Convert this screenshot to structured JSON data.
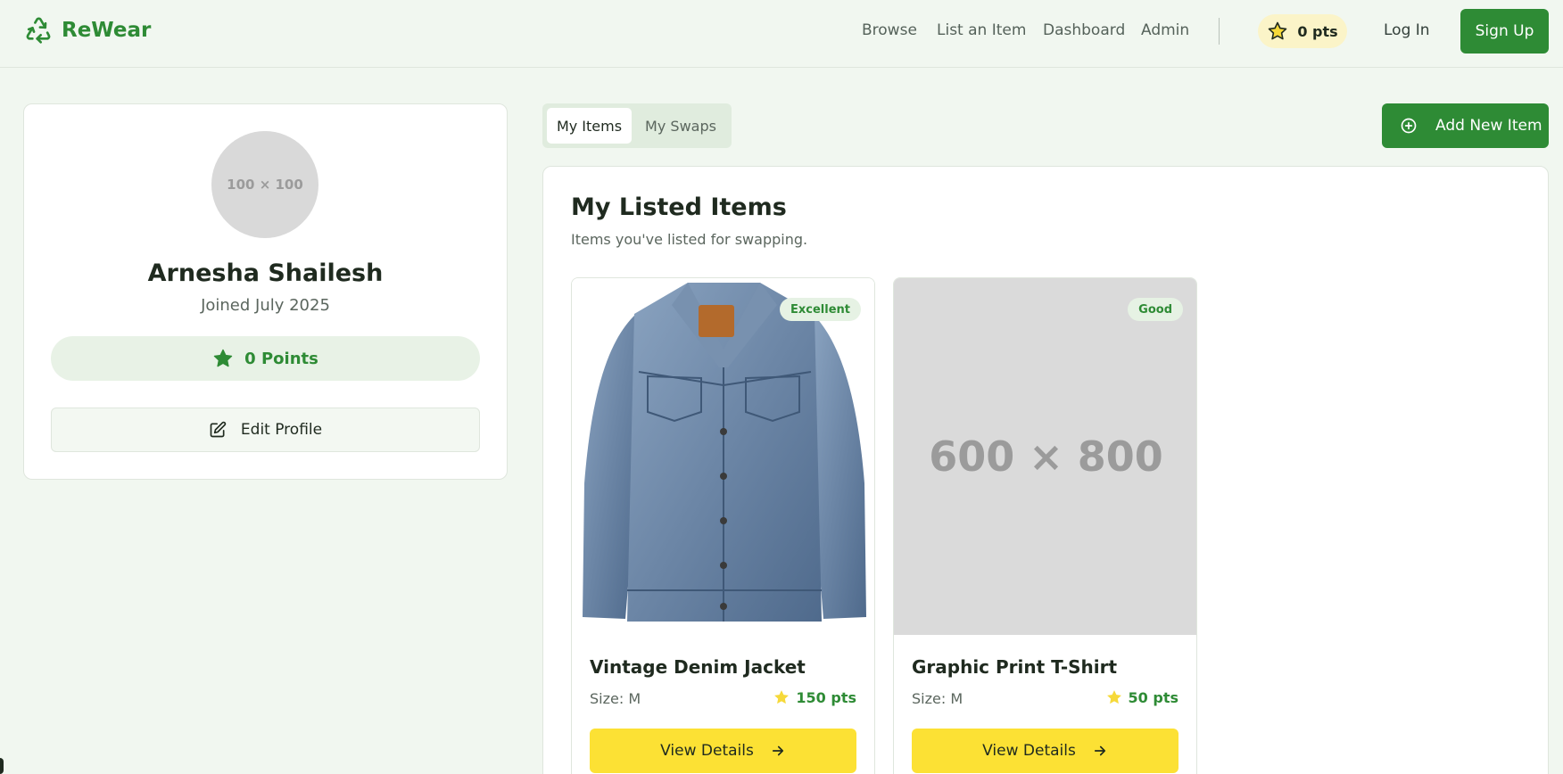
{
  "header": {
    "brand_name": "ReWear",
    "brand_icon": "recycle-icon",
    "nav": [
      {
        "label": "Browse"
      },
      {
        "label": "List an Item"
      },
      {
        "label": "Dashboard"
      },
      {
        "label": "Admin"
      }
    ],
    "points_label": "0 pts",
    "login_label": "Log In",
    "signup_label": "Sign Up"
  },
  "profile": {
    "avatar_placeholder": "100 × 100",
    "name": "Arnesha Shailesh",
    "joined": "Joined July 2025",
    "points": "0 Points",
    "edit_label": "Edit Profile"
  },
  "tabs": [
    {
      "label": "My Items",
      "active": true
    },
    {
      "label": "My Swaps",
      "active": false
    }
  ],
  "add_item_label": "Add New Item",
  "main": {
    "title": "My Listed Items",
    "subtitle": "Items you've listed for swapping."
  },
  "items": [
    {
      "name": "Vintage Denim Jacket",
      "condition": "Excellent",
      "size": "Size: M",
      "points": "150 pts",
      "image_placeholder": "",
      "view_label": "View Details"
    },
    {
      "name": "Graphic Print T-Shirt",
      "condition": "Good",
      "size": "Size: M",
      "points": "50 pts",
      "image_placeholder": "600 × 800",
      "view_label": "View Details"
    }
  ],
  "colors": {
    "primary_green": "#2e8b35",
    "accent_yellow": "#fce134",
    "background": "#f1f7f0"
  }
}
